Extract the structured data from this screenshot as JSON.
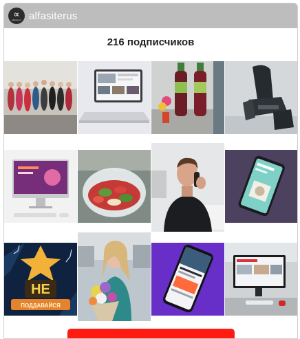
{
  "widget": {
    "brand_name": "alfasiterus",
    "logo_glyph": "∝",
    "logo_small_text": "alfasiterus",
    "subscribers_text": "216 подписчиков"
  },
  "posts": [
    {
      "name": "post-team-photo"
    },
    {
      "name": "post-laptop-website"
    },
    {
      "name": "post-bottles-flowers"
    },
    {
      "name": "post-massage-chair"
    },
    {
      "name": "post-imac-website"
    },
    {
      "name": "post-fruit-bowl"
    },
    {
      "name": "post-man-on-phone"
    },
    {
      "name": "post-smartphone-app"
    },
    {
      "name": "post-neon-sign"
    },
    {
      "name": "post-woman-flowers"
    },
    {
      "name": "post-phone-app-purple"
    },
    {
      "name": "post-office-monitor"
    }
  ],
  "neon_sign": {
    "line1": "НЕ",
    "line2": "ПОДДАВАЙСЯ"
  },
  "colors": {
    "header_bg": "#bdbdbd",
    "cta_bg": "#ff1b12",
    "text": "#222222"
  }
}
